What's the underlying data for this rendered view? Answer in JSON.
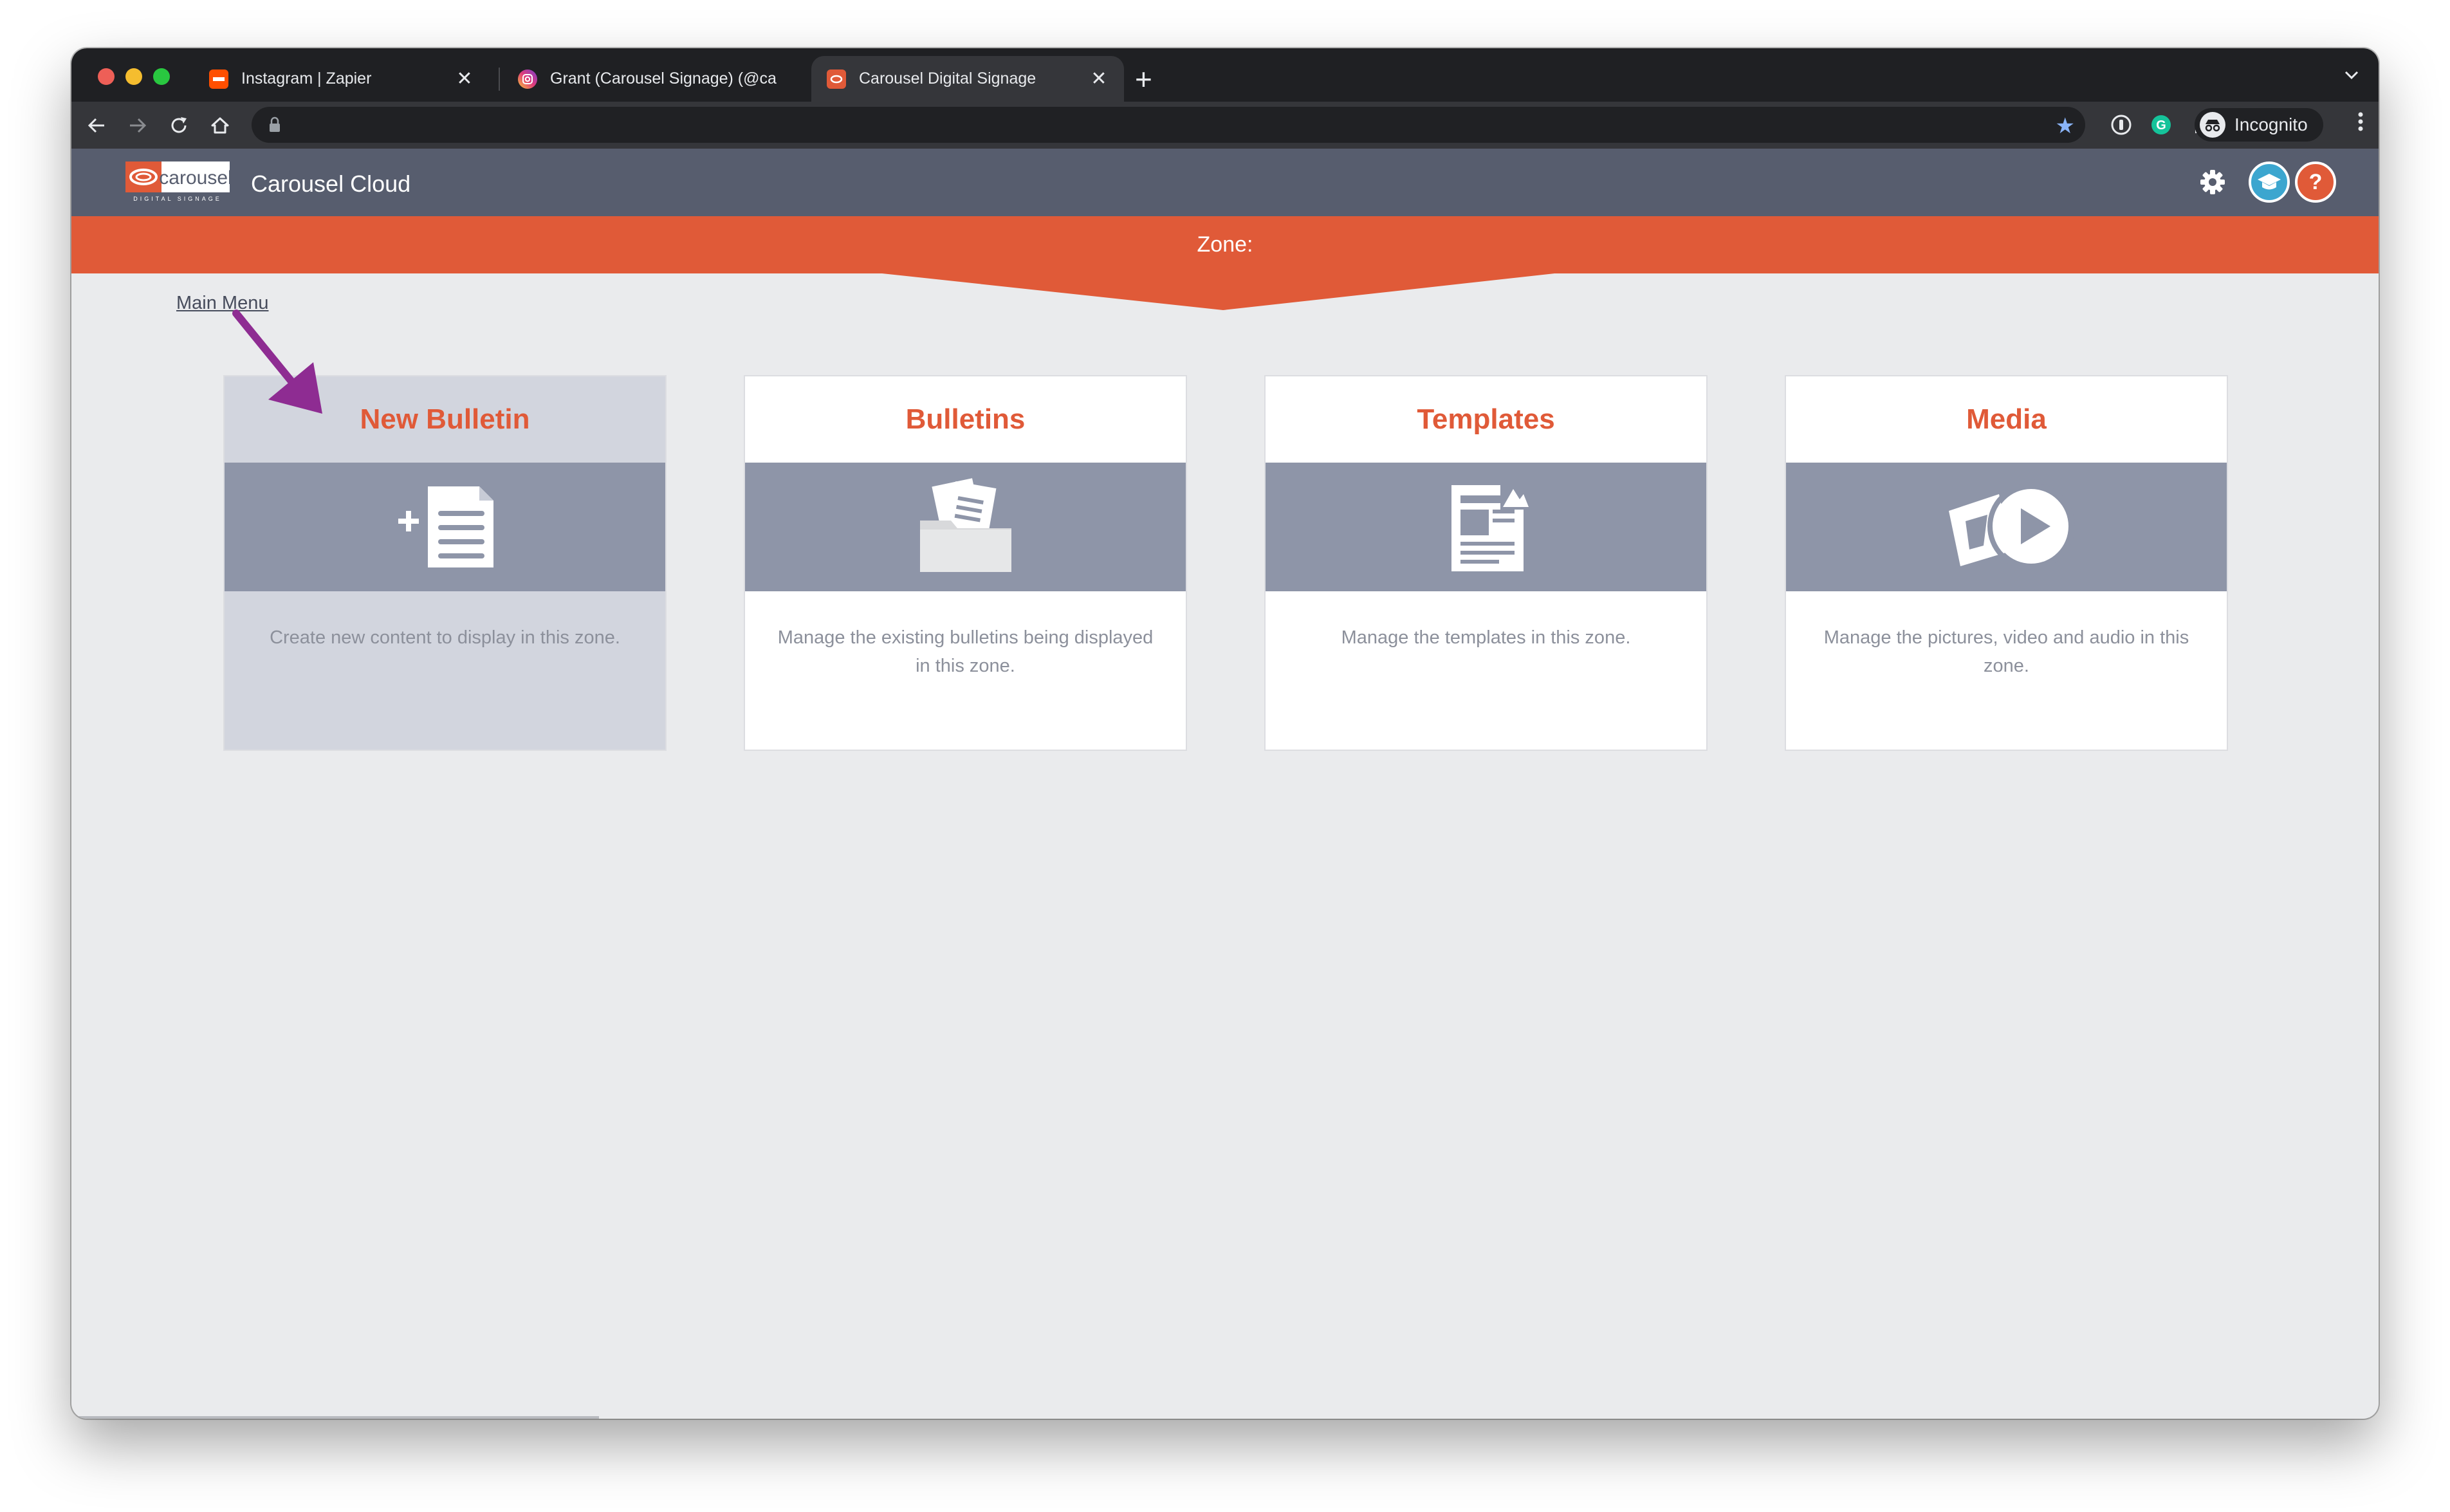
{
  "browser": {
    "tabs": [
      {
        "title": "Instagram | Zapier",
        "favicon": "zapier-icon",
        "active": false
      },
      {
        "title": "Grant (Carousel Signage) (@ca",
        "favicon": "instagram-icon",
        "active": false
      },
      {
        "title": "Carousel Digital Signage",
        "favicon": "carousel-icon",
        "active": true
      }
    ],
    "new_tab": "+",
    "profile_label": "Incognito",
    "close_glyph": "✕"
  },
  "app": {
    "logo_text": "carousel",
    "logo_subtext": "DIGITAL SIGNAGE",
    "title": "Carousel Cloud",
    "help_label": "?",
    "zone_label": "Zone:",
    "main_menu_link": "Main Menu"
  },
  "cards": [
    {
      "title": "New Bulletin",
      "icon": "new-document-icon",
      "description": "Create new content to display in this zone.",
      "selected": true
    },
    {
      "title": "Bulletins",
      "icon": "folder-documents-icon",
      "description": "Manage the existing bulletins being displayed in this zone.",
      "selected": false
    },
    {
      "title": "Templates",
      "icon": "template-icon",
      "description": "Manage the templates in this zone.",
      "selected": false
    },
    {
      "title": "Media",
      "icon": "media-icon",
      "description": "Manage the pictures, video and audio in this zone.",
      "selected": false
    }
  ],
  "colors": {
    "accent": "#e05a38",
    "header": "#575d6e",
    "band": "#8e95a8",
    "arrow": "#8e2c92",
    "page_bg": "#eaebed"
  }
}
